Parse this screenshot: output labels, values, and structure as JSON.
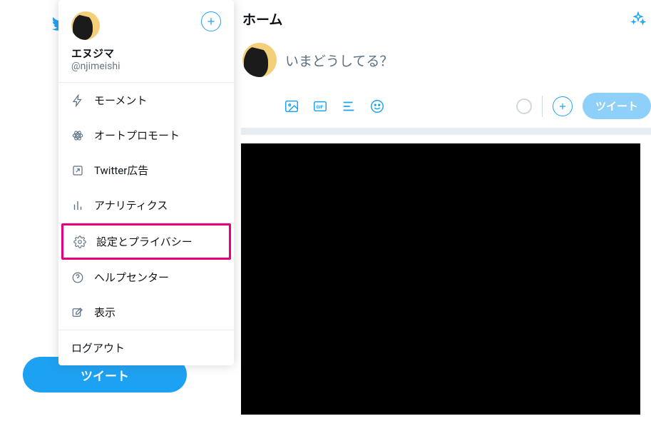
{
  "colors": {
    "accent": "#1da1f2",
    "highlight": "#e6007e"
  },
  "rail": {
    "tweet_button": "ツイート"
  },
  "popover": {
    "display_name": "エヌジマ",
    "handle": "@njimeishi",
    "items": {
      "moments": "モーメント",
      "auto_promote": "オートプロモート",
      "twitter_ads": "Twitter広告",
      "analytics": "アナリティクス",
      "settings_privacy": "設定とプライバシー",
      "help_center": "ヘルプセンター",
      "display": "表示"
    },
    "logout": "ログアウト"
  },
  "main": {
    "title": "ホーム",
    "compose_placeholder": "いまどうしてる？",
    "tweet_button": "ツイート"
  }
}
